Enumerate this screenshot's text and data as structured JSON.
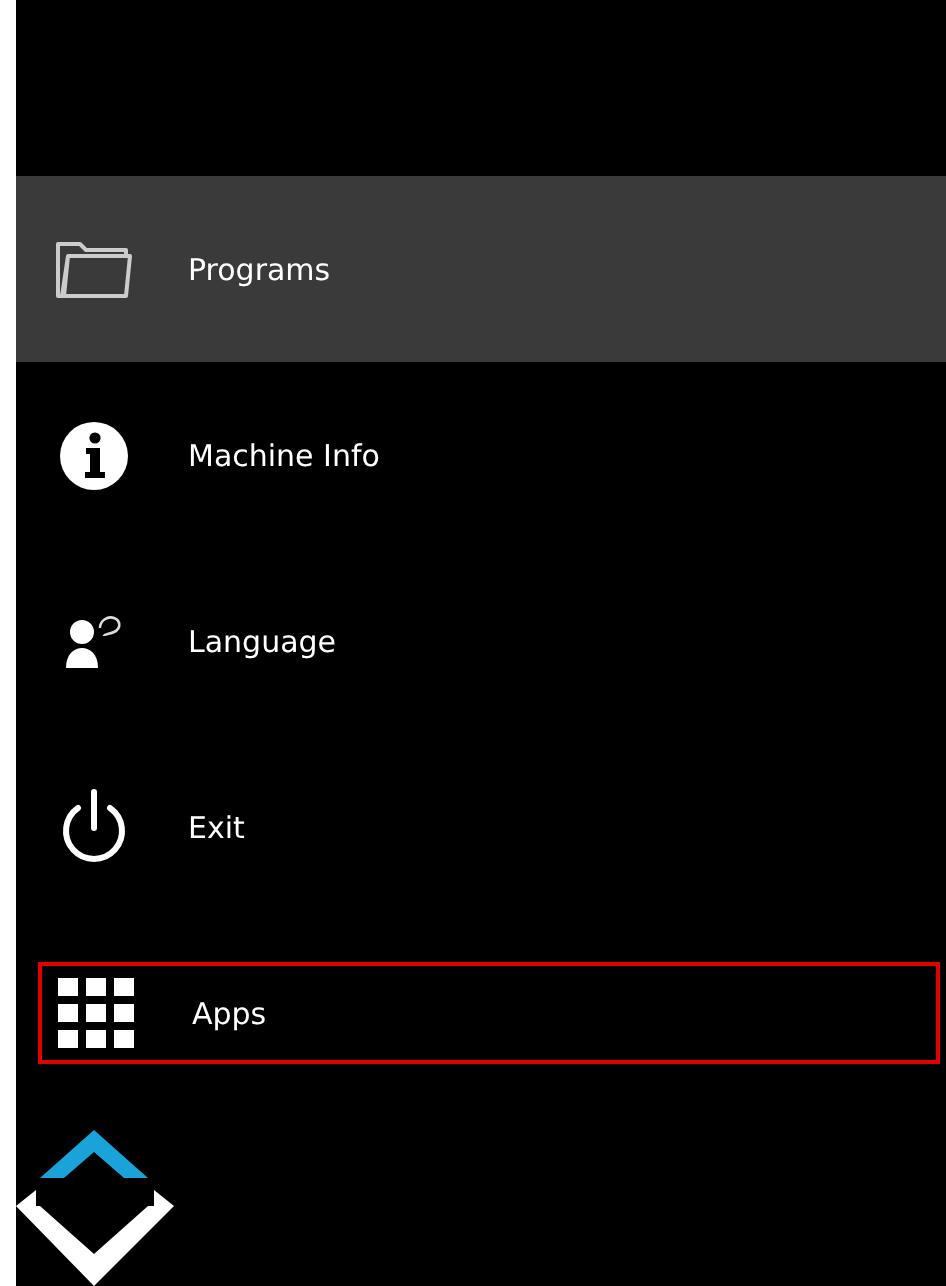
{
  "menu": {
    "items": [
      {
        "label": "Programs",
        "kind": "folder",
        "selected": true,
        "highlighted": false
      },
      {
        "label": "Machine Info",
        "kind": "info",
        "selected": false,
        "highlighted": false
      },
      {
        "label": "Language",
        "kind": "language",
        "selected": false,
        "highlighted": false
      },
      {
        "label": "Exit",
        "kind": "power",
        "selected": false,
        "highlighted": false
      },
      {
        "label": "Apps",
        "kind": "apps",
        "selected": false,
        "highlighted": true
      }
    ]
  }
}
